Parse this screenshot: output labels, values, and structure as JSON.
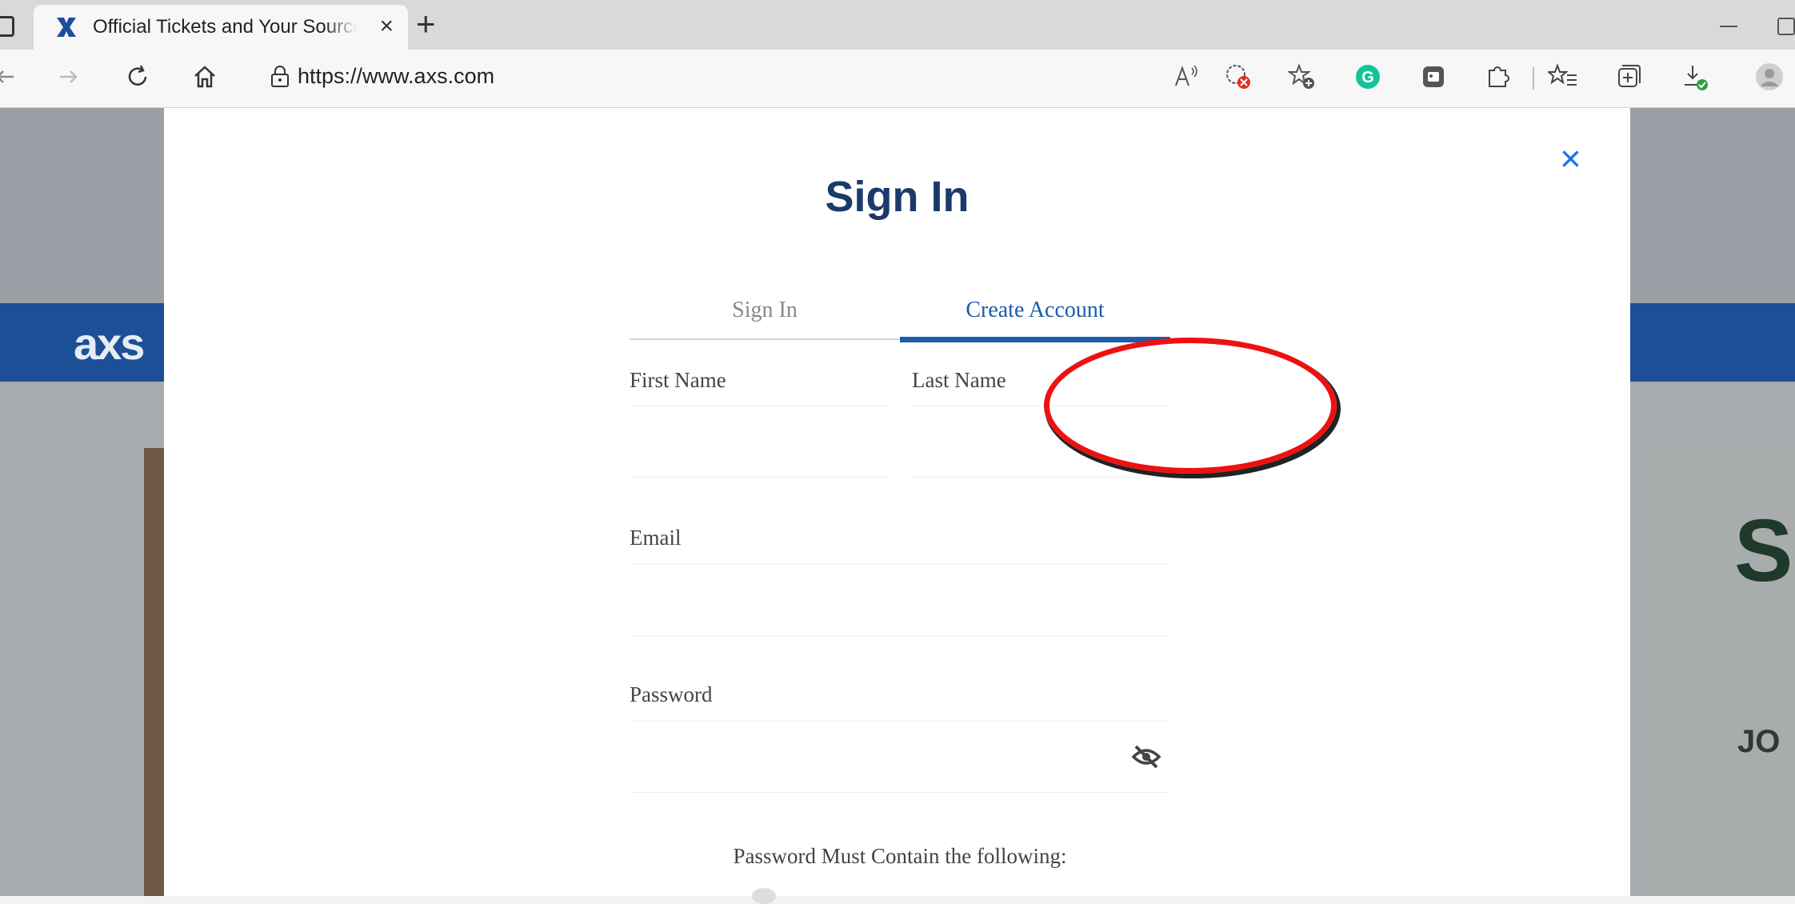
{
  "browser": {
    "tab_title": "Official Tickets and Your Source f",
    "tab_close": "×",
    "new_tab": "+",
    "url": "https://www.axs.com"
  },
  "background": {
    "logo": "axs",
    "hero_letter": "S",
    "hero_text": "JO"
  },
  "modal": {
    "close": "×",
    "title": "Sign In",
    "tabs": [
      {
        "label": "Sign In",
        "active": false
      },
      {
        "label": "Create Account",
        "active": true
      }
    ],
    "fields": {
      "first_name": {
        "label": "First Name",
        "value": ""
      },
      "last_name": {
        "label": "Last Name",
        "value": ""
      },
      "email": {
        "label": "Email",
        "value": ""
      },
      "password": {
        "label": "Password",
        "value": ""
      }
    },
    "password_note": "Password Must Contain the following:"
  },
  "colors": {
    "brand_blue": "#1b3a6b",
    "tab_active": "#1a5cab",
    "close_blue": "#1a73e8",
    "annotation_red": "#e11111"
  },
  "icons": [
    "axs-favicon",
    "back-arrow-icon",
    "forward-arrow-icon",
    "reload-icon",
    "home-icon",
    "lock-icon",
    "read-aloud-icon",
    "cookie-blocked-icon",
    "add-favorite-icon",
    "grammarly-icon",
    "extension-icon",
    "extensions-puzzle-icon",
    "favorites-icon",
    "collections-icon",
    "downloads-icon",
    "profile-icon",
    "eye-slash-icon"
  ]
}
